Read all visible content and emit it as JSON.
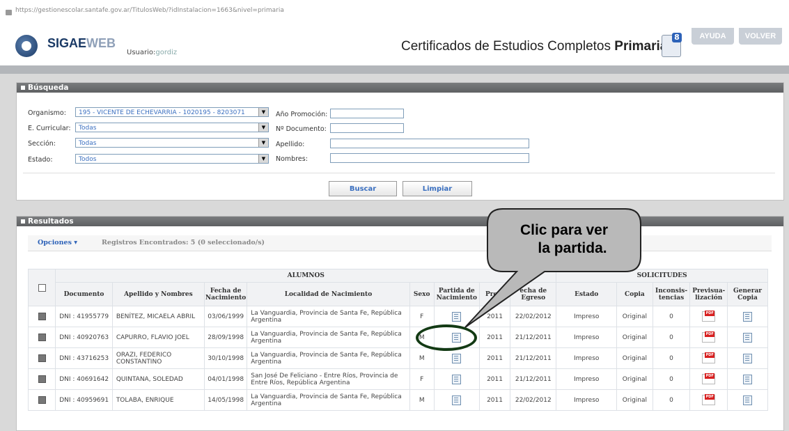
{
  "browser": {
    "url": "https://gestionescolar.santafe.gov.ar/TitulosWeb/?idInstalacion=1663&nivel=primaria"
  },
  "header": {
    "logo_main": "SIGAE",
    "logo_accent": "WEB",
    "user_label": "Usuario:",
    "user_name": "gordiz",
    "title_prefix": "Certificados de Estudios Completos ",
    "title_bold": "Primaria",
    "help_button": "AYUDA",
    "back_button": "VOLVER"
  },
  "search": {
    "heading": "Búsqueda",
    "organismo_label": "Organismo:",
    "organismo_value": "195 - VICENTE DE ECHEVARRIA - 1020195 - 8203071",
    "curricular_label": "E. Curricular:",
    "curricular_value": "Todas",
    "seccion_label": "Sección:",
    "seccion_value": "Todas",
    "estado_label": "Estado:",
    "estado_value": "Todos",
    "promocion_label": "Año Promoción:",
    "documento_label": "Nº Documento:",
    "apellido_label": "Apellido:",
    "nombres_label": "Nombres:",
    "buscar_button": "Buscar",
    "limpiar_button": "Limpiar"
  },
  "results": {
    "heading": "Resultados",
    "options_label": "Opciones",
    "records_text": "Registros Encontrados: 5 (0 seleccionado/s)",
    "group_alumnos": "ALUMNOS",
    "group_solicitudes": "SOLICITUDES",
    "columns": {
      "documento": "Documento",
      "apellido": "Apellido y Nombres",
      "fecha_nac": "Fecha de Nacimiento",
      "localidad": "Localidad de Nacimiento",
      "sexo": "Sexo",
      "partida": "Partida de Nacimiento",
      "promocion": "Prom",
      "egreso": "echa de Egreso",
      "estado": "Estado",
      "copia": "Copia",
      "inconsistencias": "Inconsis- tencias",
      "previsualizacion": "Previsua- lización",
      "generar": "Generar Copia"
    },
    "rows": [
      {
        "documento": "DNI : 41955779",
        "nombre": "BENÍTEZ, MICAELA ABRIL",
        "fecha_nac": "03/06/1999",
        "localidad": "La Vanguardia, Provincia de Santa Fe, República Argentina",
        "sexo": "F",
        "promocion": "2011",
        "egreso": "22/02/2012",
        "estado": "Impreso",
        "copia": "Original",
        "inconsistencias": "0"
      },
      {
        "documento": "DNI : 40920763",
        "nombre": "CAPURRO, FLAVIO JOEL",
        "fecha_nac": "28/09/1998",
        "localidad": "La Vanguardia, Provincia de Santa Fe, República Argentina",
        "sexo": "M",
        "promocion": "2011",
        "egreso": "21/12/2011",
        "estado": "Impreso",
        "copia": "Original",
        "inconsistencias": "0"
      },
      {
        "documento": "DNI : 43716253",
        "nombre": "ORAZI, FEDERICO CONSTANTINO",
        "fecha_nac": "30/10/1998",
        "localidad": "La Vanguardia, Provincia de Santa Fe, República Argentina",
        "sexo": "M",
        "promocion": "2011",
        "egreso": "21/12/2011",
        "estado": "Impreso",
        "copia": "Original",
        "inconsistencias": "0"
      },
      {
        "documento": "DNI : 40691642",
        "nombre": "QUINTANA, SOLEDAD",
        "fecha_nac": "04/01/1998",
        "localidad": "San José De Feliciano - Entre Ríos, Provincia de Entre Ríos, República Argentina",
        "sexo": "F",
        "promocion": "2011",
        "egreso": "21/12/2011",
        "estado": "Impreso",
        "copia": "Original",
        "inconsistencias": "0"
      },
      {
        "documento": "DNI : 40959691",
        "nombre": "TOLABA, ENRIQUE",
        "fecha_nac": "14/05/1998",
        "localidad": "La Vanguardia, Provincia de Santa Fe, República Argentina",
        "sexo": "M",
        "promocion": "2011",
        "egreso": "22/02/2012",
        "estado": "Impreso",
        "copia": "Original",
        "inconsistencias": "0"
      }
    ]
  },
  "callout": {
    "line1": "Clic para ver",
    "line2": "la partida."
  },
  "icons": {
    "partida": "document-icon",
    "preview": "pdf-icon",
    "generate": "document-icon"
  }
}
